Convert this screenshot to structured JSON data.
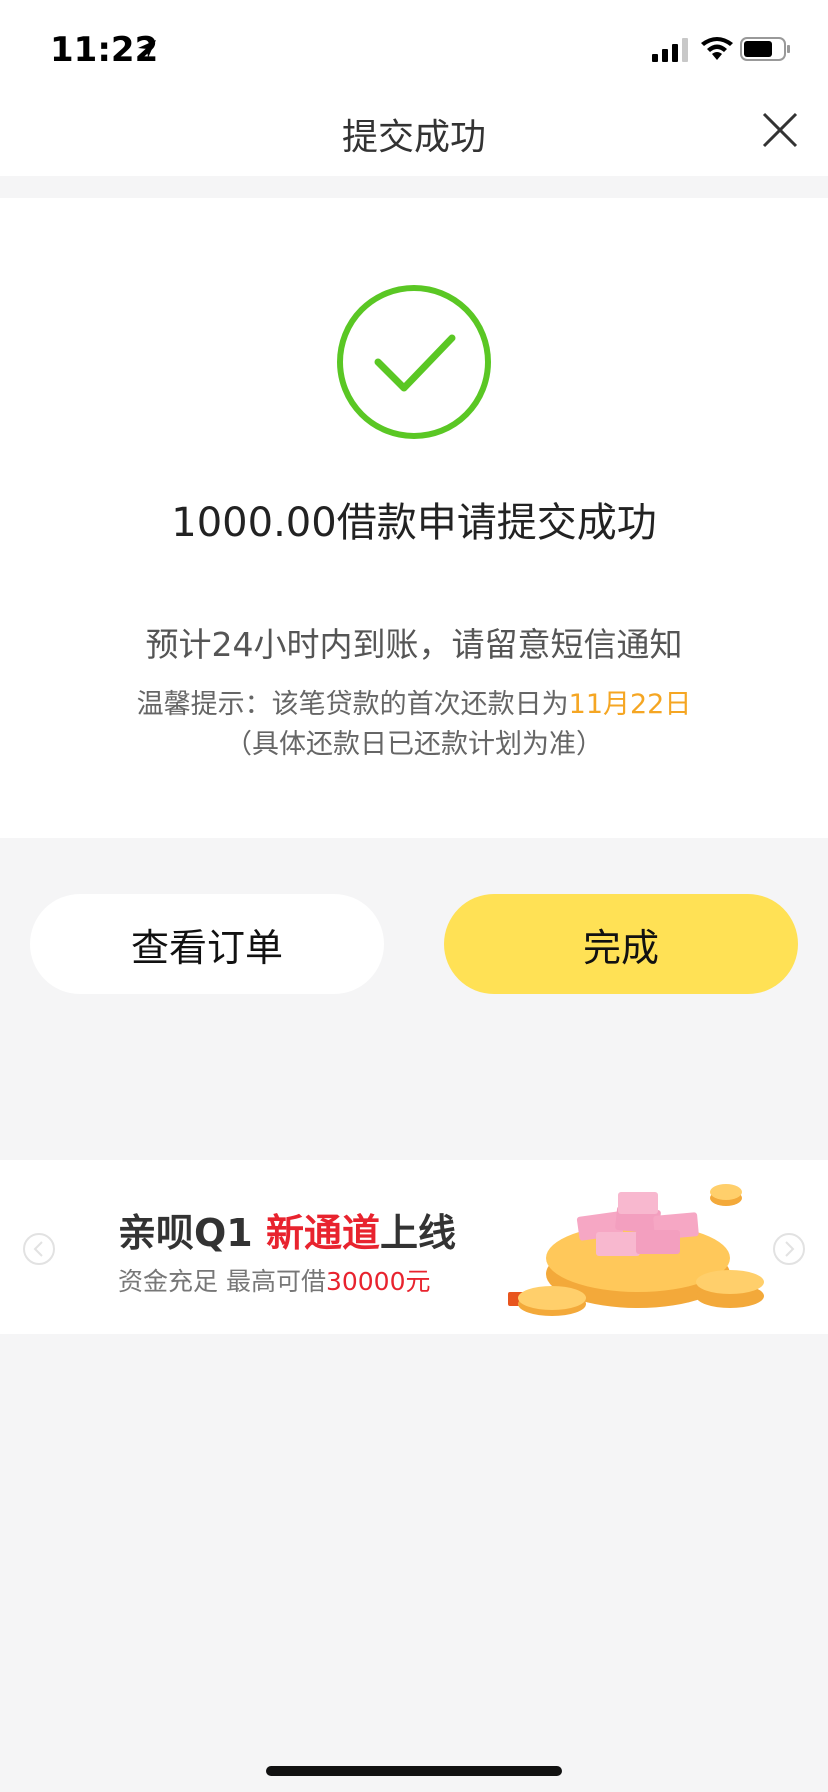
{
  "status_bar": {
    "time": "11:22",
    "icons": [
      "location-arrow-icon",
      "signal-icon",
      "wifi-icon",
      "battery-icon"
    ]
  },
  "nav": {
    "title": "提交成功",
    "close_icon": "close-icon"
  },
  "result": {
    "icon": "success-check-icon",
    "headline": "1000.00借款申请提交成功",
    "subline": "预计24小时内到账，请留意短信通知",
    "tip_prefix": "温馨提示：该笔贷款的首次还款日为",
    "tip_date": "11月22日",
    "tip_line2": "（具体还款日已还款计划为准）"
  },
  "actions": {
    "view_order_label": "查看订单",
    "done_label": "完成"
  },
  "banner": {
    "title_prefix": "亲呗Q1 ",
    "title_highlight": "新通道",
    "title_suffix": "上线",
    "sub_prefix": "资金充足 最高可借",
    "sub_amount": "30000元",
    "left_arrow": "chevron-left-icon",
    "right_arrow": "chevron-right-icon"
  },
  "colors": {
    "accent_yellow": "#ffe155",
    "success_green": "#5ac724",
    "date_orange": "#f5a623",
    "banner_red": "#e8232e",
    "background": "#f5f5f6"
  }
}
